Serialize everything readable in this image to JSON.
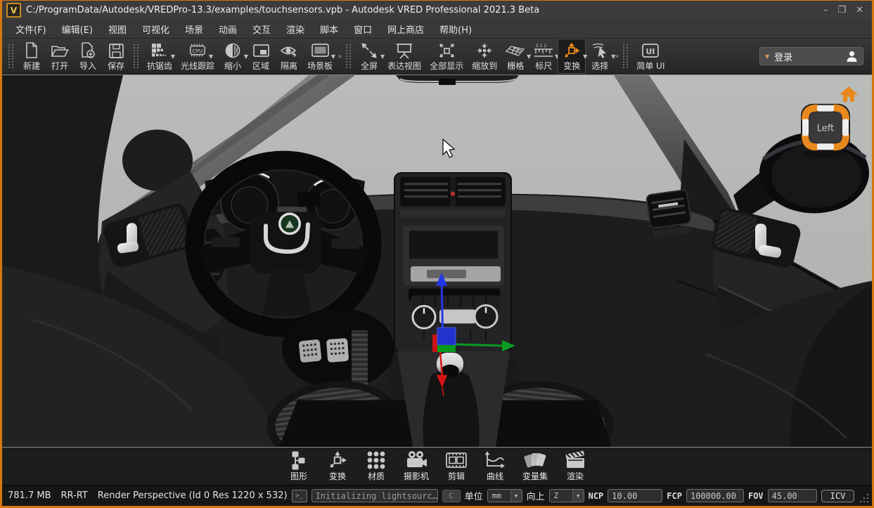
{
  "window": {
    "title": "C:/ProgramData/Autodesk/VREDPro-13.3/examples/touchsensors.vpb - Autodesk VRED Professional 2021.3 Beta",
    "logo_letter": "V",
    "controls": {
      "minimize": "–",
      "maximize": "❐",
      "close": "✕"
    }
  },
  "menu_bar": {
    "items": [
      "文件(F)",
      "编辑(E)",
      "视图",
      "可视化",
      "场景",
      "动画",
      "交互",
      "渲染",
      "脚本",
      "窗口",
      "网上商店",
      "帮助(H)"
    ]
  },
  "toolbar": {
    "buttons": [
      {
        "label": "新建",
        "icon": "new-file-icon",
        "dropdown": false,
        "active": false
      },
      {
        "label": "打开",
        "icon": "open-folder-icon",
        "dropdown": false,
        "active": false
      },
      {
        "label": "导入",
        "icon": "import-icon",
        "dropdown": false,
        "active": false
      },
      {
        "label": "保存",
        "icon": "save-icon",
        "dropdown": false,
        "active": false
      },
      {
        "label": "抗锯齿",
        "icon": "antialiasing-icon",
        "dropdown": true,
        "active": false
      },
      {
        "label": "光线跟踪",
        "icon": "cpu-raytracing-icon",
        "dropdown": true,
        "active": false
      },
      {
        "label": "缩小",
        "icon": "downscale-icon",
        "dropdown": true,
        "active": false
      },
      {
        "label": "区域",
        "icon": "region-icon",
        "dropdown": false,
        "active": false
      },
      {
        "label": "隔离",
        "icon": "isolate-eye-icon",
        "dropdown": false,
        "active": false
      },
      {
        "label": "场景板",
        "icon": "sceneplate-icon",
        "dropdown": true,
        "active": false
      },
      {
        "label": "全屏",
        "icon": "fullscreen-icon",
        "dropdown": true,
        "active": false
      },
      {
        "label": "表达视图",
        "icon": "presentation-icon",
        "dropdown": false,
        "active": false
      },
      {
        "label": "全部显示",
        "icon": "show-all-icon",
        "dropdown": false,
        "active": false
      },
      {
        "label": "缩放到",
        "icon": "zoom-to-icon",
        "dropdown": false,
        "active": false
      },
      {
        "label": "栅格",
        "icon": "grid-icon",
        "dropdown": true,
        "active": false
      },
      {
        "label": "标尺",
        "icon": "ruler-icon",
        "dropdown": true,
        "active": false
      },
      {
        "label": "变换",
        "icon": "transform-icon",
        "dropdown": true,
        "active": true
      },
      {
        "label": "选择",
        "icon": "select-cursor-icon",
        "dropdown": true,
        "active": false
      },
      {
        "label": "简单 UI",
        "icon": "simple-ui-icon",
        "dropdown": false,
        "active": false
      }
    ],
    "login": {
      "label": "登录",
      "icon": "user-icon"
    }
  },
  "viewport": {
    "cube_label": "Left",
    "overlays": [
      "home-icon",
      "view-cube",
      "transform-gizmo",
      "mouse-cursor"
    ],
    "gizmo_axes": {
      "up": "blue",
      "right": "green",
      "down": "red"
    }
  },
  "bottom_toolbar": {
    "items": [
      {
        "label": "图形",
        "icon": "scenegraph-icon"
      },
      {
        "label": "变换",
        "icon": "transform-icon"
      },
      {
        "label": "材质",
        "icon": "material-icon"
      },
      {
        "label": "摄影机",
        "icon": "camera-icon"
      },
      {
        "label": "剪辑",
        "icon": "clips-icon"
      },
      {
        "label": "曲线",
        "icon": "curve-icon"
      },
      {
        "label": "变量集",
        "icon": "variant-sets-icon"
      },
      {
        "label": "渲染",
        "icon": "render-icon"
      }
    ]
  },
  "status_bar": {
    "memory": "781.7 MB",
    "mode": "RR-RT",
    "render_info": "Render Perspective (Id 0 Res 1220 x 532)",
    "console_text": "Initializing lightsourc…",
    "c_button": "C",
    "units_label": "单位",
    "units_value": "mm",
    "up_label": "向上",
    "up_value": "Z",
    "ncp_label": "NCP",
    "ncp_value": "10.00",
    "fcp_label": "FCP",
    "fcp_value": "100000.00",
    "fov_label": "FOV",
    "fov_value": "45.00",
    "icv_button": "ICV"
  },
  "colors": {
    "accent_orange": "#e8891d",
    "window_border": "#d3770f",
    "sky": "#b6b8b6",
    "axis_x": "#d81414",
    "axis_y": "#0a9c22",
    "axis_z": "#2437e8"
  }
}
